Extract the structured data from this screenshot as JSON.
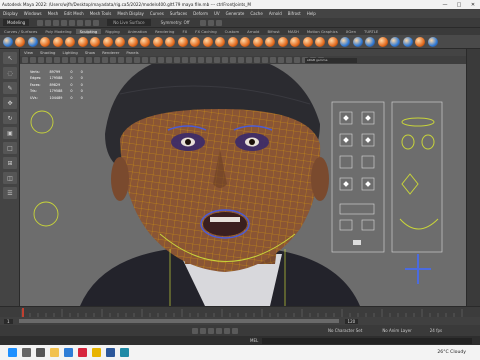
{
  "window": {
    "title": "Autodesk Maya 2022: /Users/wjfh/Desktop/mayadata/rig.ca5/2022/models400.gltf.79 maya file.mb  ---  ctrlFrontJoints_M",
    "min": "—",
    "max": "□",
    "close": "✕"
  },
  "menubar": [
    "Display",
    "Windows",
    "Mesh",
    "Edit Mesh",
    "Mesh Tools",
    "Mesh Display",
    "Curves",
    "Surfaces",
    "Deform",
    "UV",
    "Generate",
    "Cache",
    "Arnold",
    "Bifrost",
    "Help"
  ],
  "statusline": {
    "workspace": "Modeling",
    "search_placeholder": "No Live Surface",
    "symmetry": "Symmetry: Off"
  },
  "shelf_tabs": [
    "Curves / Surfaces",
    "Poly Modeling",
    "Sculpting",
    "Rigging",
    "Animation",
    "Rendering",
    "FX",
    "FX Caching",
    "Custom",
    "Arnold",
    "Bifrost",
    "MASH",
    "Motion Graphics",
    "XGen",
    "TURTLE"
  ],
  "shelf_active_index": 2,
  "shelf_icon_colors": [
    "#2b78d6",
    "#e36b1f",
    "#2b78d6",
    "#e36b1f",
    "#e36b1f",
    "#e36b1f",
    "#e36b1f",
    "#e36b1f",
    "#e36b1f",
    "#e36b1f",
    "#e36b1f",
    "#e36b1f",
    "#e36b1f",
    "#e36b1f",
    "#e36b1f",
    "#e36b1f",
    "#e36b1f",
    "#e36b1f",
    "#e36b1f",
    "#e36b1f",
    "#e36b1f",
    "#e36b1f",
    "#e36b1f",
    "#e36b1f",
    "#e36b1f",
    "#e36b1f",
    "#e36b1f",
    "#2b78d6",
    "#2b78d6",
    "#2b78d6",
    "#e36b1f",
    "#2b78d6",
    "#2b78d6",
    "#e36b1f",
    "#2b78d6"
  ],
  "panel_menu": [
    "View",
    "Shading",
    "Lighting",
    "Show",
    "Renderer",
    "Panels"
  ],
  "hud": {
    "rows": [
      {
        "label": "Verts:",
        "v1": "89799",
        "v2": "0",
        "v3": "0"
      },
      {
        "label": "Edges:",
        "v1": "179588",
        "v2": "0",
        "v3": "0"
      },
      {
        "label": "Faces:",
        "v1": "89829",
        "v2": "0",
        "v3": "0"
      },
      {
        "label": "Tris:",
        "v1": "179588",
        "v2": "0",
        "v3": "0"
      },
      {
        "label": "UVs:",
        "v1": "104489",
        "v2": "0",
        "v3": "0"
      }
    ],
    "colorspace": "sRGB gamma"
  },
  "timeline": {
    "current_frame": "1",
    "range_end": "120",
    "character_set": "No Character Set",
    "anim_layer": "No Anim Layer",
    "fps": "24 fps"
  },
  "cmdline": {
    "label": "MEL"
  },
  "taskbar": {
    "weather": "26°C  Cloudy",
    "apps": [
      "start-icon",
      "search-icon",
      "taskview-icon",
      "explorer-icon",
      "browser-icon",
      "opera-icon",
      "chrome-icon",
      "word-icon",
      "maya-icon"
    ],
    "app_colors": [
      "#1e90ff",
      "#666666",
      "#555555",
      "#f2c14e",
      "#2e7dd7",
      "#d7263d",
      "#e8b400",
      "#2b579a",
      "#1f8aa6"
    ]
  },
  "colors": {
    "accent": "#e36b1f",
    "wire": "#f4b400",
    "selection": "#4b5bd6",
    "control": "#c8d43a"
  }
}
